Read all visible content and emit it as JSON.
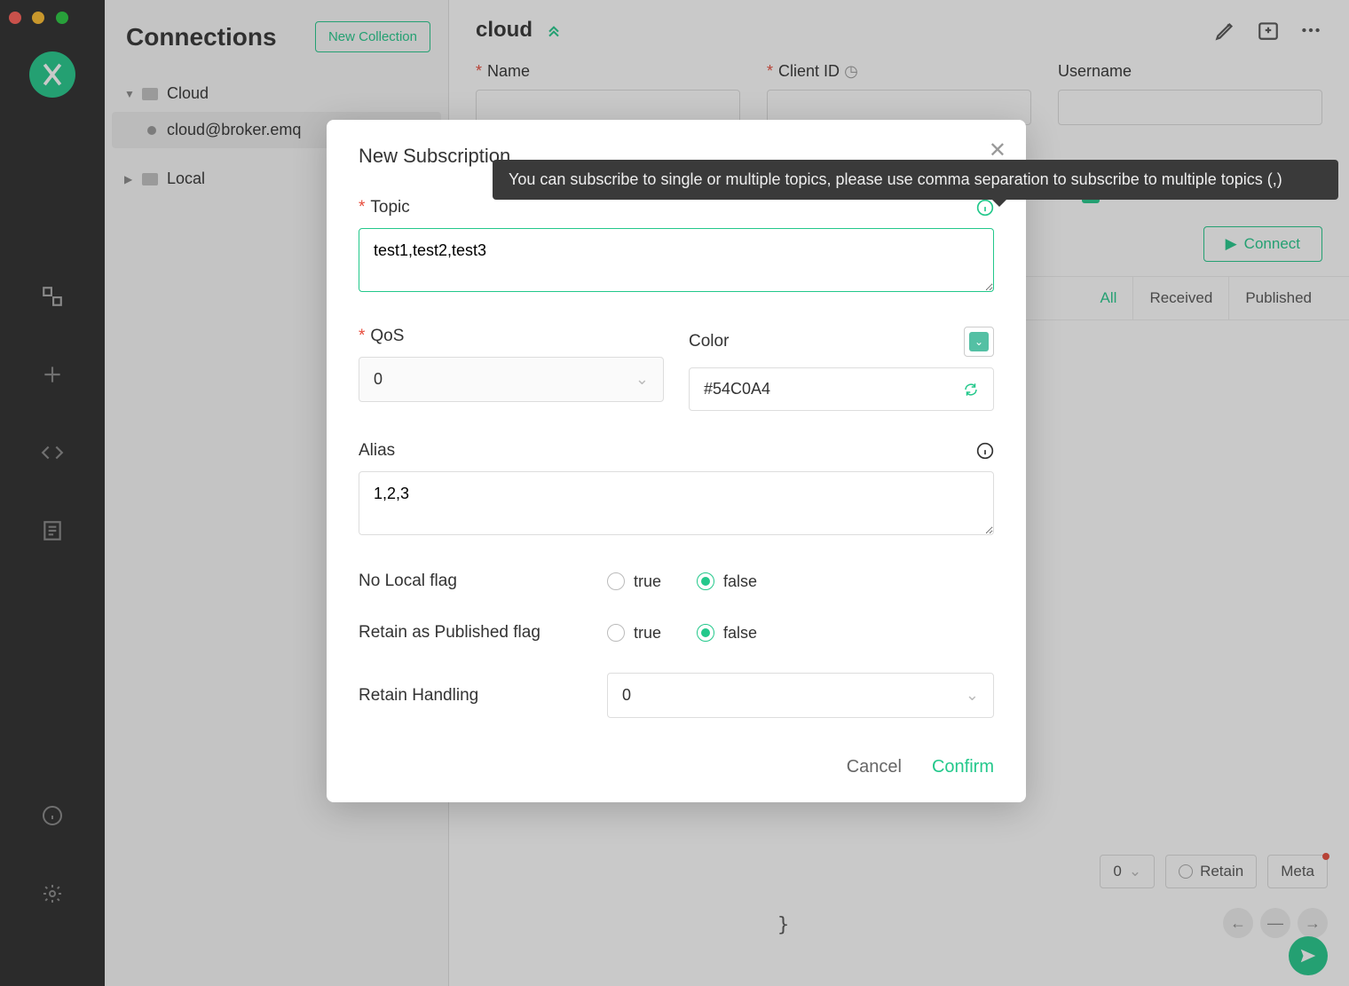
{
  "window": {
    "title": "Connections"
  },
  "sidebar_btn_new": "New Collection",
  "tree": {
    "cloud": "Cloud",
    "cloud_item": "cloud@broker.emq",
    "local": "Local"
  },
  "main": {
    "title": "cloud",
    "name_label": "Name",
    "clientid_label": "Client ID",
    "username_label": "Username",
    "checkbox_true": "true",
    "connect": "Connect",
    "tabs": {
      "all": "All",
      "received": "Received",
      "published": "Published"
    },
    "qos_value": "0",
    "retain": "Retain",
    "meta": "Meta",
    "curly": "}"
  },
  "tooltip": "You can subscribe to single or multiple topics, please use comma separation to subscribe to multiple topics (,)",
  "modal": {
    "title": "New Subscription",
    "topic_label": "Topic",
    "topic_value": "test1,test2,test3",
    "qos_label": "QoS",
    "qos_value": "0",
    "color_label": "Color",
    "color_value": "#54C0A4",
    "alias_label": "Alias",
    "alias_value": "1,2,3",
    "nolocal_label": "No Local flag",
    "rap_label": "Retain as Published flag",
    "true": "true",
    "false": "false",
    "rh_label": "Retain Handling",
    "rh_value": "0",
    "cancel": "Cancel",
    "confirm": "Confirm"
  },
  "colors": {
    "accent": "#23c88b",
    "swatch": "#54C0A4"
  }
}
